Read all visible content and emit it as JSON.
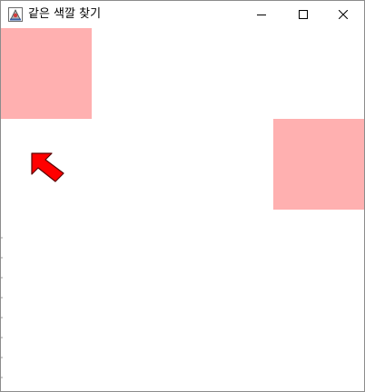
{
  "window": {
    "title": "같은 색깔 찾기",
    "icon": "java-app-icon",
    "controls": [
      "minimize-icon",
      "maximize-icon",
      "close-icon"
    ]
  },
  "board": {
    "grid_size": 4,
    "background": "#ffffff",
    "highlight_color": "#ffb0b0",
    "tiles": [
      {
        "row": 0,
        "col": 0,
        "color": "#ffb0b0"
      },
      {
        "row": 0,
        "col": 1,
        "color": "#ffffff"
      },
      {
        "row": 0,
        "col": 2,
        "color": "#ffffff"
      },
      {
        "row": 0,
        "col": 3,
        "color": "#ffffff"
      },
      {
        "row": 1,
        "col": 0,
        "color": "#ffffff"
      },
      {
        "row": 1,
        "col": 1,
        "color": "#ffffff"
      },
      {
        "row": 1,
        "col": 2,
        "color": "#ffffff"
      },
      {
        "row": 1,
        "col": 3,
        "color": "#ffb0b0"
      },
      {
        "row": 2,
        "col": 0,
        "color": "#ffffff"
      },
      {
        "row": 2,
        "col": 1,
        "color": "#ffffff"
      },
      {
        "row": 2,
        "col": 2,
        "color": "#ffffff"
      },
      {
        "row": 2,
        "col": 3,
        "color": "#ffffff"
      },
      {
        "row": 3,
        "col": 0,
        "color": "#ffffff"
      },
      {
        "row": 3,
        "col": 1,
        "color": "#ffffff"
      },
      {
        "row": 3,
        "col": 2,
        "color": "#ffffff"
      },
      {
        "row": 3,
        "col": 3,
        "color": "#ffffff"
      }
    ]
  },
  "pointer": {
    "icon": "red-arrow-pointer-icon",
    "color": "#ff0000"
  }
}
